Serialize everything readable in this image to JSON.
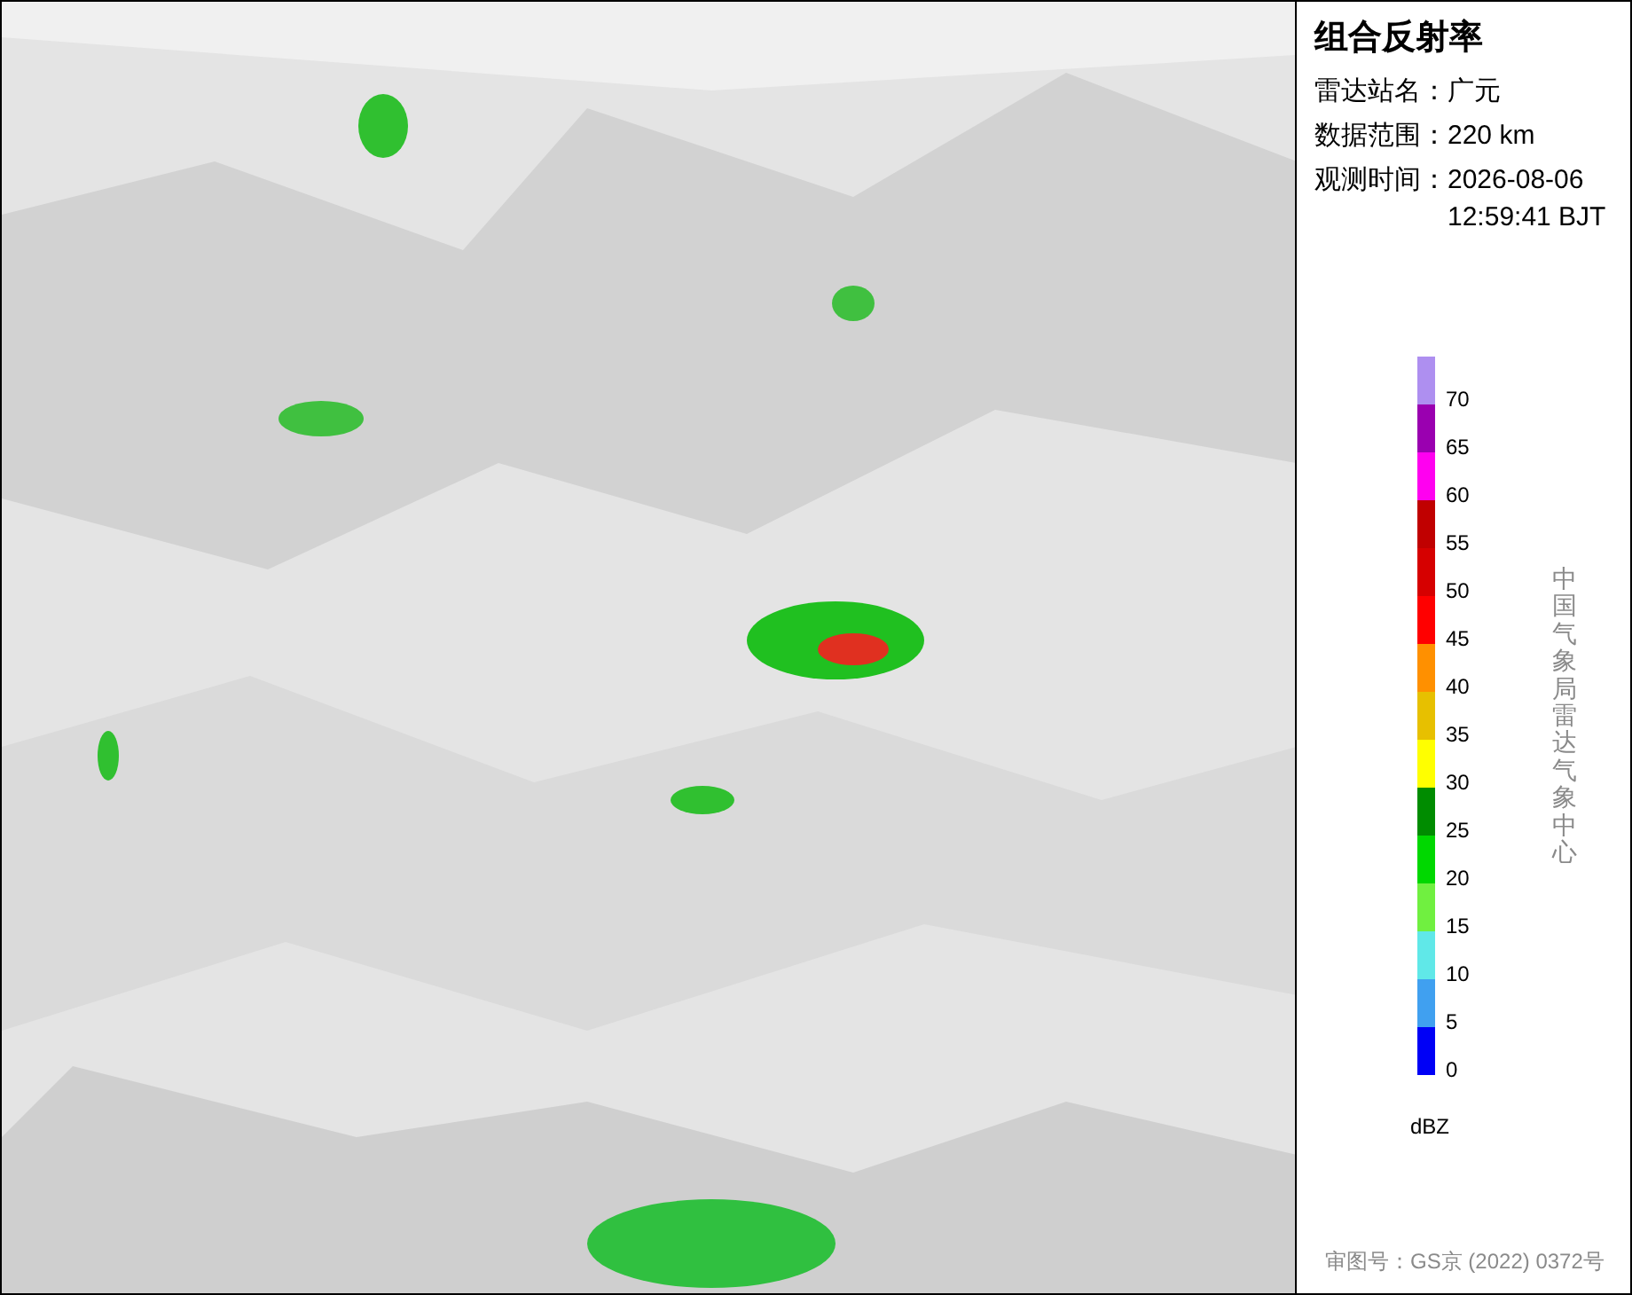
{
  "panel": {
    "title": "组合反射率",
    "info": [
      {
        "label": "雷达站名：",
        "value": [
          "广元"
        ]
      },
      {
        "label": "数据范围：",
        "value": [
          "220 km"
        ]
      },
      {
        "label": "观测时间：",
        "value": [
          "2026-08-06",
          "12:59:41 BJT"
        ]
      }
    ],
    "legend": [
      {
        "color": "#ae8ff0",
        "label": "70"
      },
      {
        "color": "#9a00b0",
        "label": "65"
      },
      {
        "color": "#ff00f0",
        "label": "60"
      },
      {
        "color": "#c00000",
        "label": "55"
      },
      {
        "color": "#d60000",
        "label": "50"
      },
      {
        "color": "#ff0000",
        "label": "45"
      },
      {
        "color": "#ff9000",
        "label": "40"
      },
      {
        "color": "#e7c000",
        "label": "35"
      },
      {
        "color": "#ffff00",
        "label": "30"
      },
      {
        "color": "#008c00",
        "label": "25"
      },
      {
        "color": "#00d800",
        "label": "20"
      },
      {
        "color": "#70f040",
        "label": "15"
      },
      {
        "color": "#60e8e8",
        "label": "10"
      },
      {
        "color": "#40a0f0",
        "label": "5"
      },
      {
        "color": "#0000f6",
        "label": "0"
      }
    ],
    "unit": "dBZ",
    "credit": "中国气象局雷达气象中心",
    "approval": "审图号：GS京 (2022) 0372号"
  }
}
